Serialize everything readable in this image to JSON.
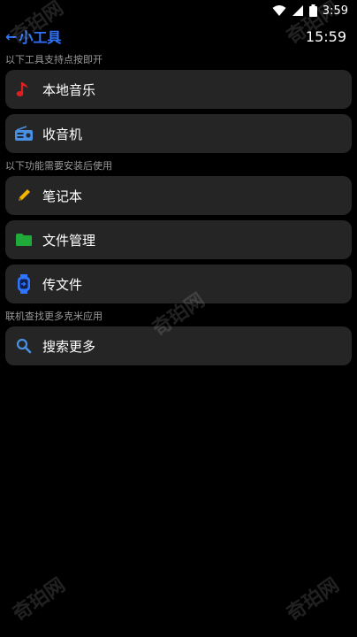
{
  "status_bar": {
    "time": "3:59"
  },
  "app_bar": {
    "back_arrow": "←",
    "title": "小工具",
    "clock": "15:59"
  },
  "sections": [
    {
      "label": "以下工具支持点按即开"
    },
    {
      "label": "以下功能需要安装后使用"
    },
    {
      "label": "联机查找更多克米应用"
    }
  ],
  "items": [
    {
      "label": "本地音乐",
      "icon": "music-note-icon",
      "color": "#e02020"
    },
    {
      "label": "收音机",
      "icon": "radio-icon",
      "color": "#4a90e2"
    },
    {
      "label": "笔记本",
      "icon": "pencil-icon",
      "color": "#f5b400"
    },
    {
      "label": "文件管理",
      "icon": "folder-icon",
      "color": "#1faa3a"
    },
    {
      "label": "传文件",
      "icon": "watch-transfer-icon",
      "color": "#2f74ff"
    },
    {
      "label": "搜索更多",
      "icon": "search-icon",
      "color": "#4a90e2"
    }
  ],
  "watermark": "奇珀网",
  "colors": {
    "accent": "#2f74ff",
    "card_bg": "#252525",
    "background": "#000000"
  }
}
